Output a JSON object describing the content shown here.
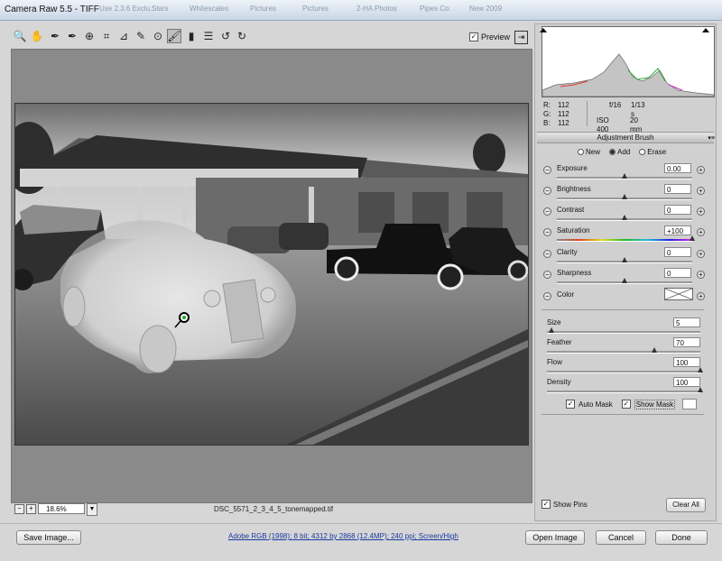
{
  "window": {
    "title": "Camera Raw 5.5  -  TIFF"
  },
  "ghost_taskbar": [
    "Use 2.3.6 Exclu...",
    "Stars",
    "Whitescales",
    "Pictures",
    "Pictures",
    "2-HA Photos",
    "Pipes Co.",
    "New 2009"
  ],
  "toolbar": {
    "tools": [
      {
        "name": "zoom-tool",
        "glyph": "🔍"
      },
      {
        "name": "hand-tool",
        "glyph": "✋"
      },
      {
        "name": "white-balance-tool",
        "glyph": "✒"
      },
      {
        "name": "color-sampler-tool",
        "glyph": "✒"
      },
      {
        "name": "target-adjustment-tool",
        "glyph": "⊕"
      },
      {
        "name": "crop-tool",
        "glyph": "⌗"
      },
      {
        "name": "straighten-tool",
        "glyph": "⊿"
      },
      {
        "name": "spot-removal-tool",
        "glyph": "✎"
      },
      {
        "name": "red-eye-tool",
        "glyph": "⊙"
      },
      {
        "name": "adjustment-brush-tool",
        "glyph": "🖌",
        "active": true
      },
      {
        "name": "graduated-filter-tool",
        "glyph": "▮"
      },
      {
        "name": "preferences-tool",
        "glyph": "☰"
      },
      {
        "name": "rotate-ccw-tool",
        "glyph": "↺"
      },
      {
        "name": "rotate-cw-tool",
        "glyph": "↻"
      }
    ],
    "preview_label": "Preview",
    "preview_checked": true
  },
  "status": {
    "zoom_minus": "−",
    "zoom_plus": "+",
    "zoom_value": "18.6%",
    "filename": "DSC_5571_2_3_4_5_tonemapped.tif"
  },
  "readout": {
    "r_label": "R:",
    "r_value": "112",
    "g_label": "G:",
    "g_value": "112",
    "b_label": "B:",
    "b_value": "112",
    "aperture": "f/16",
    "shutter": "1/13 s",
    "iso": "ISO 400",
    "focal": "20 mm"
  },
  "panel": {
    "title": "Adjustment Brush",
    "modes": [
      {
        "label": "New",
        "selected": false
      },
      {
        "label": "Add",
        "selected": true
      },
      {
        "label": "Erase",
        "selected": false
      }
    ],
    "adjustments": [
      {
        "label": "Exposure",
        "value": "0.00",
        "level": 0.5
      },
      {
        "label": "Brightness",
        "value": "0",
        "level": 0.5
      },
      {
        "label": "Contrast",
        "value": "0",
        "level": 0.5
      },
      {
        "label": "Saturation",
        "value": "+100",
        "level": 1.0
      },
      {
        "label": "Clarity",
        "value": "0",
        "level": 0.5
      },
      {
        "label": "Sharpness",
        "value": "0",
        "level": 0.5
      }
    ],
    "color_label": "Color",
    "brush": [
      {
        "label": "Size",
        "value": "5",
        "level": 0.03
      },
      {
        "label": "Feather",
        "value": "70",
        "level": 0.7
      },
      {
        "label": "Flow",
        "value": "100",
        "level": 1.0
      },
      {
        "label": "Density",
        "value": "100",
        "level": 1.0
      }
    ],
    "auto_mask_label": "Auto Mask",
    "show_mask_label": "Show Mask",
    "show_pins_label": "Show Pins",
    "clear_all_label": "Clear All"
  },
  "footer": {
    "save_label": "Save Image...",
    "workflow_label": "Adobe RGB (1998); 8 bit; 4312 by 2868 (12.4MP); 240 ppi; Screen/High",
    "open_label": "Open Image",
    "cancel_label": "Cancel",
    "done_label": "Done"
  }
}
